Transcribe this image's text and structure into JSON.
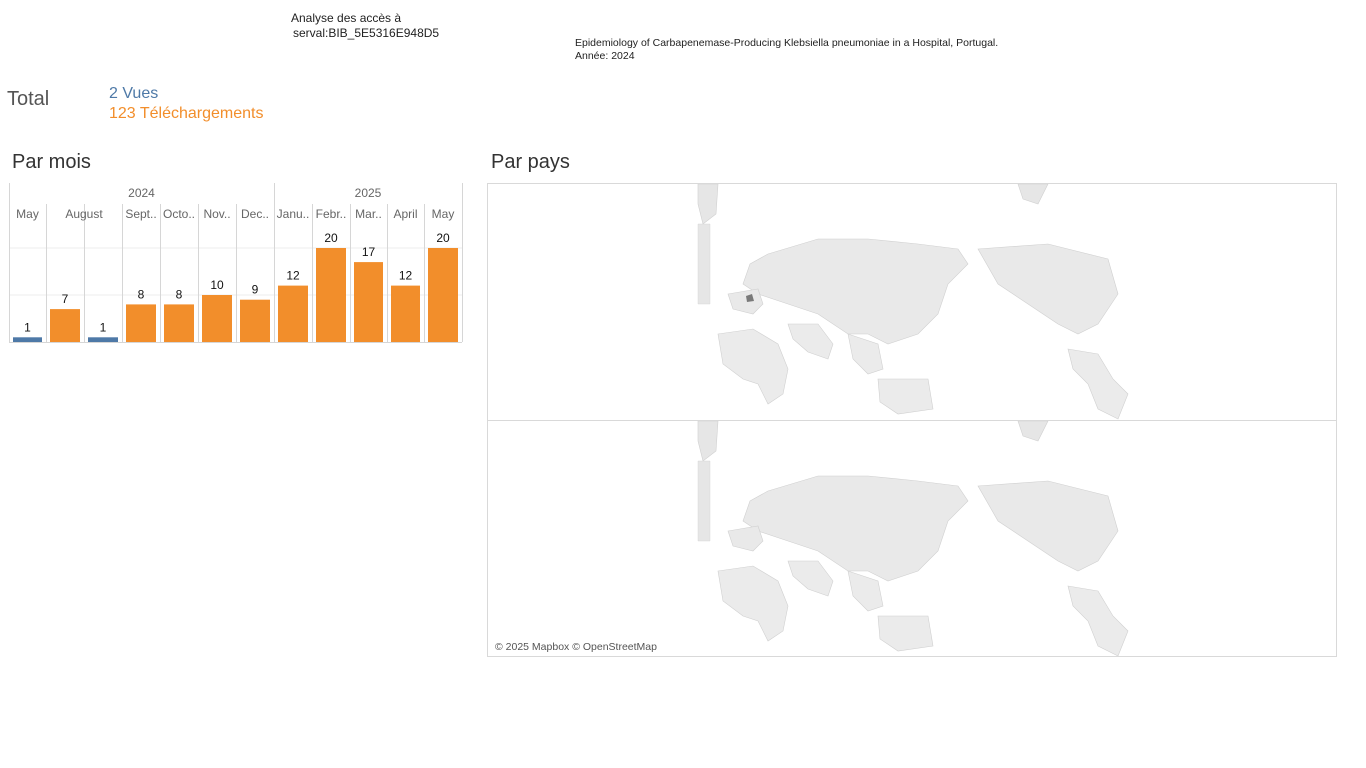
{
  "header": {
    "analysis_line1": "Analyse des accès à",
    "analysis_line2": "serval:BIB_5E5316E948D5",
    "publication_title": "Epidemiology of Carbapenemase-Producing Klebsiella pneumoniae in a Hospital, Portugal.",
    "publication_year": "Année: 2024"
  },
  "totals": {
    "label": "Total",
    "views": "2 Vues",
    "downloads": "123 Téléchargements"
  },
  "sections": {
    "monthly": "Par mois",
    "country": "Par pays"
  },
  "map": {
    "credit": "© 2025 Mapbox © OpenStreetMap"
  },
  "colors": {
    "views": "#4e79a7",
    "downloads": "#f28e2b"
  },
  "chart_data": {
    "type": "bar",
    "years": [
      {
        "label": "2024",
        "span": [
          0,
          6
        ]
      },
      {
        "label": "2025",
        "span": [
          7,
          11
        ]
      }
    ],
    "categories": [
      "May",
      "August",
      "",
      "Sept..",
      "Octo..",
      "Nov..",
      "Dec..",
      "Janu..",
      "Febr..",
      "Mar..",
      "April",
      "May"
    ],
    "series": [
      {
        "name": "Vues",
        "color": "#4e79a7",
        "values": [
          1,
          0,
          1,
          0,
          0,
          0,
          0,
          0,
          0,
          0,
          0,
          0
        ]
      },
      {
        "name": "Téléchargements",
        "color": "#f28e2b",
        "values": [
          0,
          7,
          0,
          8,
          8,
          10,
          9,
          12,
          20,
          17,
          12,
          20
        ]
      }
    ],
    "ylim": [
      0,
      20
    ]
  }
}
